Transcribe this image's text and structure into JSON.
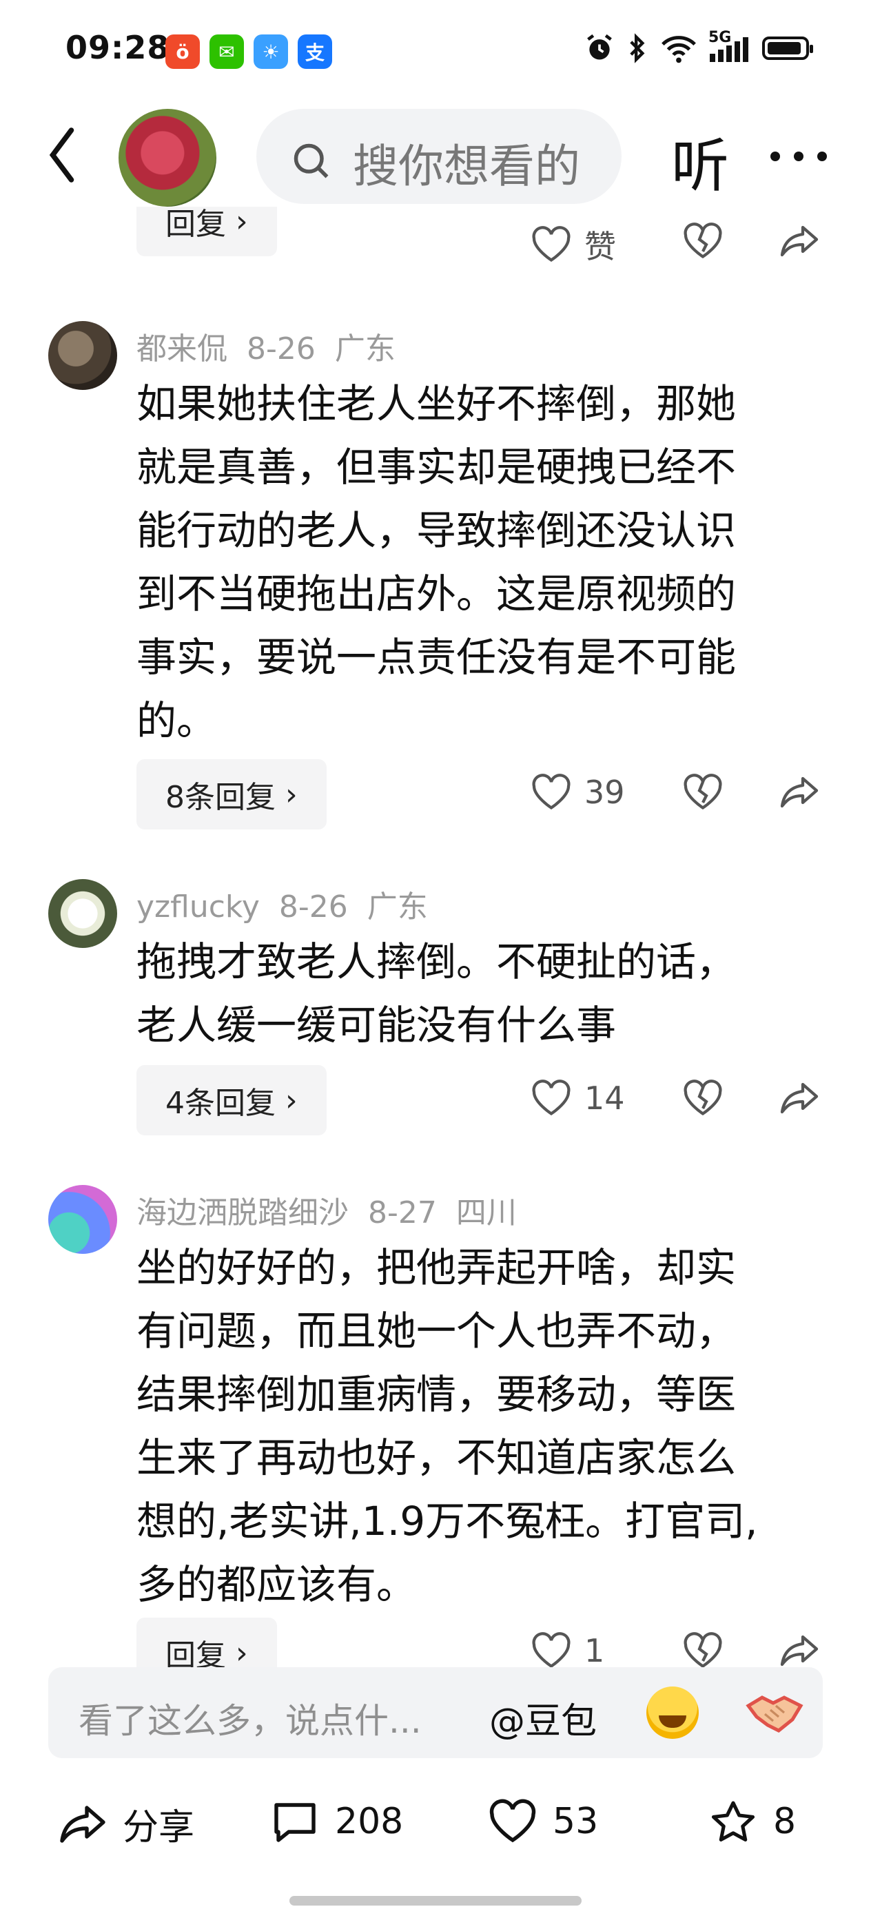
{
  "status": {
    "time": "09:28",
    "network": "5G"
  },
  "header": {
    "search_placeholder": "搜你想看的",
    "listen_label": "听"
  },
  "top_item": {
    "reply_label": "回复",
    "like_label": "赞"
  },
  "comments": [
    {
      "author": "都来侃",
      "date": "8-26",
      "location": "广东",
      "lines": [
        "如果她扶住老人坐好不摔倒，那她",
        "就是真善，但事实却是硬拽已经不",
        "能行动的老人，导致摔倒还没认识",
        "到不当硬拖出店外。这是原视频的",
        "事实，要说一点责任没有是不可能",
        "的。"
      ],
      "reply_label": "8条回复",
      "likes": "39"
    },
    {
      "author": "yzflucky",
      "date": "8-26",
      "location": "广东",
      "lines": [
        "拖拽才致老人摔倒。不硬扯的话，",
        "老人缓一缓可能没有什么事"
      ],
      "reply_label": "4条回复",
      "likes": "14"
    },
    {
      "author": "海边洒脱踏细沙",
      "date": "8-27",
      "location": "四川",
      "lines": [
        "坐的好好的，把他弄起开啥，却实",
        "有问题，而且她一个人也弄不动，",
        "结果摔倒加重病情，要移动，等医",
        "生来了再动也好，不知道店家怎么",
        "想的,老实讲,1.9万不冤枉。打官司,",
        "多的都应该有。"
      ],
      "reply_label": "回复",
      "likes": "1"
    }
  ],
  "input": {
    "placeholder": "看了这么多，说点什...",
    "mention": "@豆包"
  },
  "bottom": {
    "share_label": "分享",
    "comments_count": "208",
    "likes_count": "53",
    "favorites_count": "8"
  },
  "colors": {
    "meta": "#9a9a9a",
    "button_bg": "#f4f4f5"
  }
}
